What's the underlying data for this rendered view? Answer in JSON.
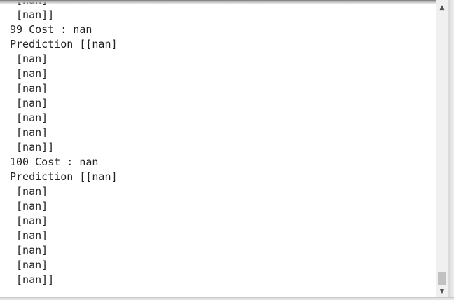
{
  "console": {
    "lines": [
      " [nan]",
      " [nan]]",
      "99 Cost : nan",
      "Prediction [[nan]",
      " [nan]",
      " [nan]",
      " [nan]",
      " [nan]",
      " [nan]",
      " [nan]",
      " [nan]]",
      "100 Cost : nan",
      "Prediction [[nan]",
      " [nan]",
      " [nan]",
      " [nan]",
      " [nan]",
      " [nan]",
      " [nan]",
      " [nan]]"
    ]
  },
  "scrollbar": {
    "up_icon": "triangle-up",
    "down_icon": "triangle-down",
    "position": 0.97
  },
  "colors": {
    "background": "#ffffff",
    "text": "#222222",
    "scroll_track": "#f0f0f0",
    "scroll_thumb": "#c1c1c1"
  }
}
